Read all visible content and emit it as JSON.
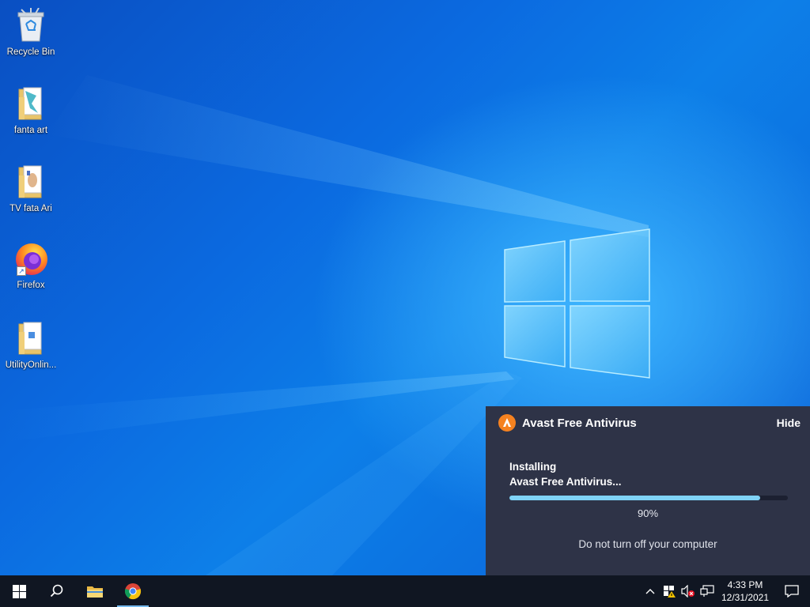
{
  "desktop": {
    "icons": [
      {
        "label": "Recycle Bin",
        "icon": "recycle-bin-icon"
      },
      {
        "label": "fanta art",
        "icon": "folder-icon"
      },
      {
        "label": "TV  fata Ari",
        "icon": "folder-icon"
      },
      {
        "label": "Firefox",
        "icon": "firefox-icon"
      },
      {
        "label": "UtilityOnlin...",
        "icon": "folder-icon"
      }
    ]
  },
  "popup": {
    "title": "Avast Free Antivirus",
    "hide_label": "Hide",
    "status_line1": "Installing",
    "status_line2": "Avast Free Antivirus...",
    "progress_percent": 90,
    "percent_label": "90%",
    "warning": "Do not turn off your computer",
    "colors": {
      "background": "#2e3347",
      "accent": "#f58220",
      "progress": "#7fd3f7"
    }
  },
  "taskbar": {
    "pinned": [
      {
        "name": "start",
        "icon": "windows-icon"
      },
      {
        "name": "search",
        "icon": "search-icon"
      },
      {
        "name": "file-explorer",
        "icon": "folder-icon"
      },
      {
        "name": "chrome",
        "icon": "chrome-icon",
        "active": true
      }
    ],
    "tray": {
      "time": "4:33 PM",
      "date": "12/31/2021"
    }
  }
}
